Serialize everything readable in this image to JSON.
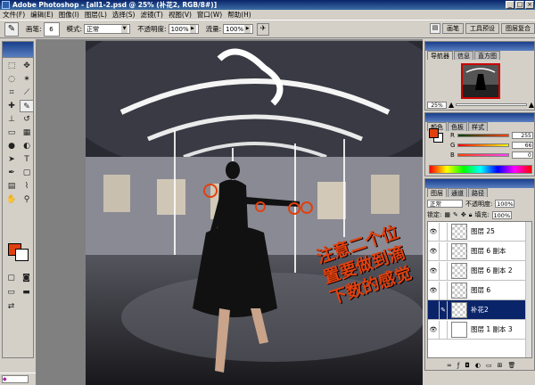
{
  "window": {
    "title": "Adobe Photoshop - [all1-2.psd @ 25% (补花2, RGB/8#)]"
  },
  "menu": [
    "文件(F)",
    "编辑(E)",
    "图像(I)",
    "图层(L)",
    "选择(S)",
    "滤镜(T)",
    "视图(V)",
    "窗口(W)",
    "帮助(H)"
  ],
  "options": {
    "brush_label": "画笔:",
    "brush_size": "6",
    "mode_label": "模式:",
    "mode_value": "正常",
    "opacity_label": "不透明度:",
    "opacity_value": "100%",
    "flow_label": "流量:",
    "flow_value": "100%"
  },
  "palette_well": [
    "画笔",
    "工具预设",
    "图层复合"
  ],
  "navigator": {
    "tabs": [
      "导航器",
      "信息",
      "直方图"
    ],
    "zoom": "25%"
  },
  "color": {
    "tabs": [
      "颜色",
      "色板",
      "样式"
    ],
    "foreground": "#e1400e",
    "r": "255",
    "g": "66",
    "b": "0"
  },
  "layers": {
    "tabs": [
      "图层",
      "通道",
      "路径"
    ],
    "blend_mode": "正常",
    "opacity_label": "不透明度:",
    "opacity_value": "100%",
    "lock_label": "锁定:",
    "fill_label": "填充:",
    "fill_value": "100%",
    "items": [
      {
        "name": "图层 25",
        "selected": false
      },
      {
        "name": "图层 6 副本",
        "selected": false
      },
      {
        "name": "图层 6 副本 2",
        "selected": false
      },
      {
        "name": "图层 6",
        "selected": false
      },
      {
        "name": "补花2",
        "selected": true
      },
      {
        "name": "图层 1 副本 3",
        "selected": false
      }
    ]
  },
  "annotation": {
    "text": "注意二个位置要做到滴下数的感觉",
    "color": "#e1400e"
  },
  "accent_color": "#0a246a"
}
